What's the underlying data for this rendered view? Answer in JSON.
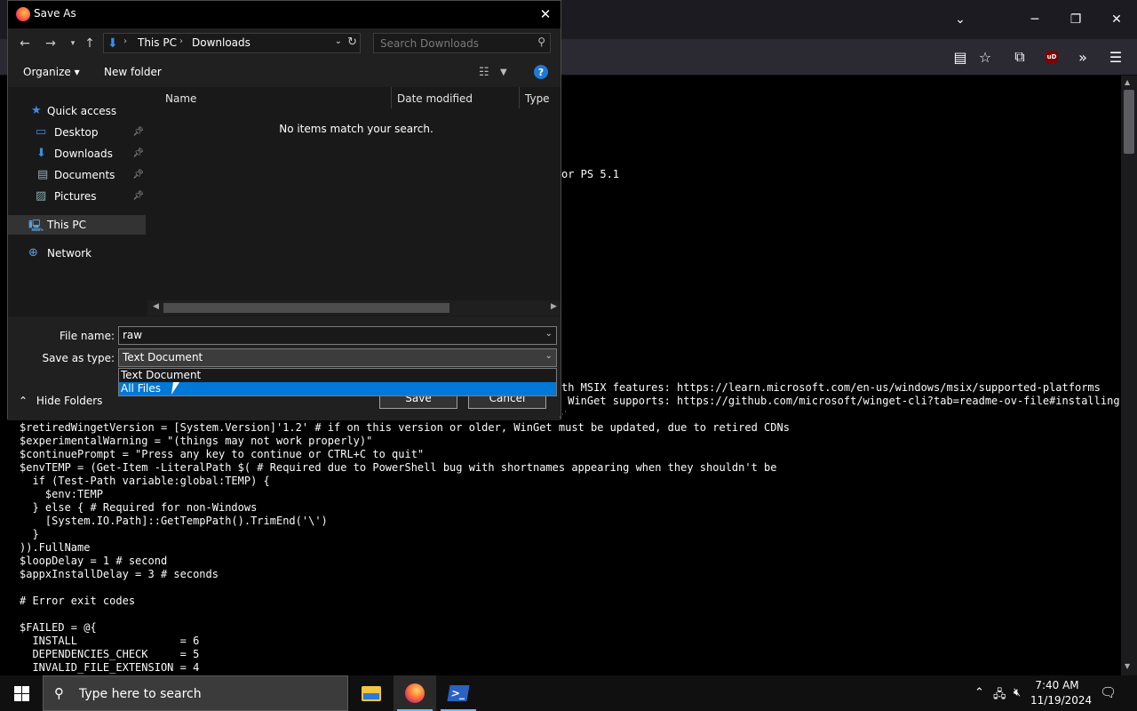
{
  "browser": {
    "toolbar_icons": [
      "reader-view-icon",
      "bookmark-star-icon",
      "extensions-icon",
      "ublock-icon",
      "overflow-icon",
      "menu-icon"
    ],
    "ublock_label": "uD",
    "code_lines": [
      "or PS 5.1",
      "th MSIX features: https://learn.microsoft.com/en-us/windows/msix/supported-platforms",
      " WinGet supports: https://github.com/microsoft/winget-cli?tab=readme-ov-file#installing-",
      "$retiredWingetVersion = [System.Version]'1.2' # if on this version or older, WinGet must be updated, due to retired CDNs",
      "$experimentalWarning = \"(things may not work properly)\"",
      "$continuePrompt = \"Press any key to continue or CTRL+C to quit\"",
      "$envTEMP = (Get-Item -LiteralPath $( # Required due to PowerShell bug with shortnames appearing when they shouldn't be",
      "  if (Test-Path variable:global:TEMP) {",
      "    $env:TEMP",
      "  } else { # Required for non-Windows",
      "    [System.IO.Path]::GetTempPath().TrimEnd('\\')",
      "  }",
      ")).FullName",
      "$loopDelay = 1 # second",
      "$appxInstallDelay = 3 # seconds",
      "",
      "# Error exit codes",
      "",
      "$FAILED = @{",
      "  INSTALL                = 6",
      "  DEPENDENCIES_CHECK     = 5",
      "  INVALID_FILE_EXTENSION = 4"
    ]
  },
  "dialog": {
    "title": "Save As",
    "breadcrumb": [
      "This PC",
      "Downloads"
    ],
    "search_placeholder": "Search Downloads",
    "toolbar": {
      "organize_label": "Organize ▾",
      "new_folder_label": "New folder",
      "help_label": "?"
    },
    "nav_items": [
      {
        "label": "Quick access",
        "icon": "star-icon",
        "pinned": false
      },
      {
        "label": "Desktop",
        "icon": "desktop-icon",
        "pinned": true
      },
      {
        "label": "Downloads",
        "icon": "download-icon",
        "pinned": true
      },
      {
        "label": "Documents",
        "icon": "document-icon",
        "pinned": true
      },
      {
        "label": "Pictures",
        "icon": "pictures-icon",
        "pinned": true
      },
      {
        "label": "This PC",
        "icon": "computer-icon",
        "pinned": false,
        "selected": true
      },
      {
        "label": "Network",
        "icon": "network-icon",
        "pinned": false
      }
    ],
    "columns": [
      "Name",
      "Date modified",
      "Type"
    ],
    "empty_message": "No items match your search.",
    "form": {
      "file_name_label": "File name:",
      "file_name_value": "raw",
      "save_type_label": "Save as type:",
      "save_type_value": "Text Document",
      "type_options": [
        "Text Document",
        "All Files"
      ],
      "highlighted_option": "All Files",
      "save_label": "Save",
      "cancel_label": "Cancel",
      "hide_folders_label": "Hide Folders"
    }
  },
  "taskbar": {
    "search_placeholder": "Type here to search",
    "apps": [
      "file-explorer",
      "firefox",
      "powershell"
    ],
    "clock_time": "7:40 AM",
    "clock_date": "11/19/2024"
  },
  "colors": {
    "accent": "#0078d7",
    "taskbar_active_underline": "#76b9ed"
  }
}
